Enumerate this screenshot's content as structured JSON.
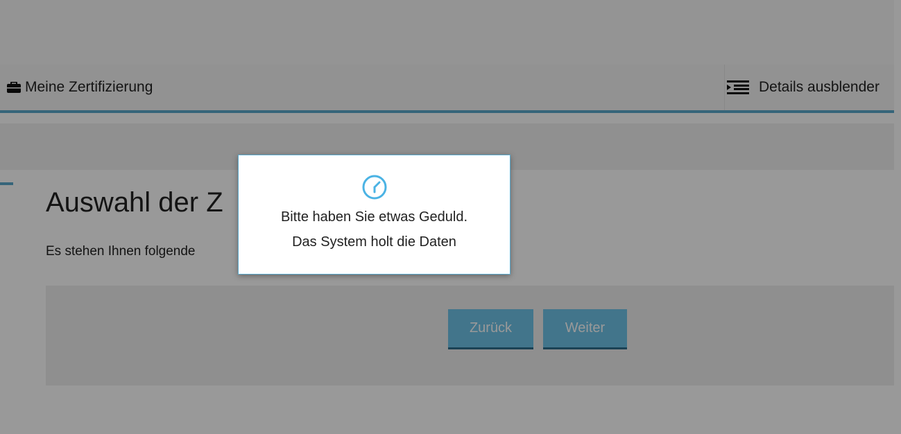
{
  "header": {
    "left_label": "Meine Zertifizierung",
    "left_icon": "briefcase-icon",
    "right_label": "Details ausblender",
    "right_icon": "indent-list-icon"
  },
  "main": {
    "title": "Auswahl der Z",
    "description": "Es stehen Ihnen folgende                                                                    fügung:",
    "buttons": {
      "back": "Zurück",
      "next": "Weiter"
    }
  },
  "modal": {
    "icon": "clock-icon",
    "line1": "Bitte haben Sie etwas Geduld.",
    "line2": "Das System holt die Daten"
  },
  "colors": {
    "accent": "#5aa9cc",
    "button": "#6fc4e8",
    "button_border": "#2d6f8c",
    "overlay": "rgba(0,0,0,0.4)"
  }
}
